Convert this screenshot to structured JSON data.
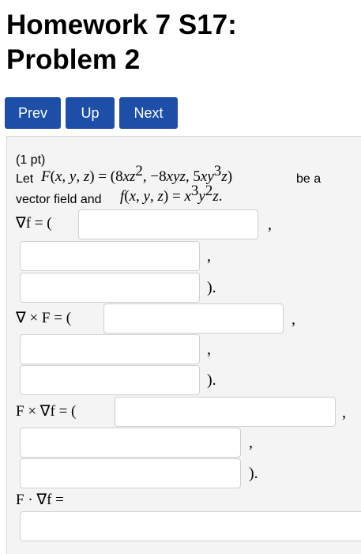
{
  "page": {
    "title": "Homework 7 S17: Problem 2"
  },
  "nav": {
    "prev_label": "Prev",
    "up_label": "Up",
    "next_label": "Next",
    "button_color": "#1e4fa8"
  },
  "problem": {
    "points": "(1 pt)",
    "intro_let": "Let",
    "intro_be_a": "be a",
    "intro_vector_field": "vector field and",
    "F_def": "F(x, y, z) = (8xz², −8xyz, 5xy³z)",
    "f_def": "f(x, y, z) = x³y²z.",
    "labels": {
      "grad_f": "∇f = (",
      "curl_F": "∇ × F = (",
      "F_cross_grad_f": "F × ∇f = (",
      "F_dot_grad_f": "F · ∇f ="
    },
    "separators": {
      "comma": ",",
      "close": ")."
    },
    "answers": {
      "grad_f": [
        "",
        "",
        ""
      ],
      "curl_F": [
        "",
        "",
        ""
      ],
      "F_cross_grad_f": [
        "",
        "",
        ""
      ],
      "F_dot_grad_f": ""
    }
  }
}
